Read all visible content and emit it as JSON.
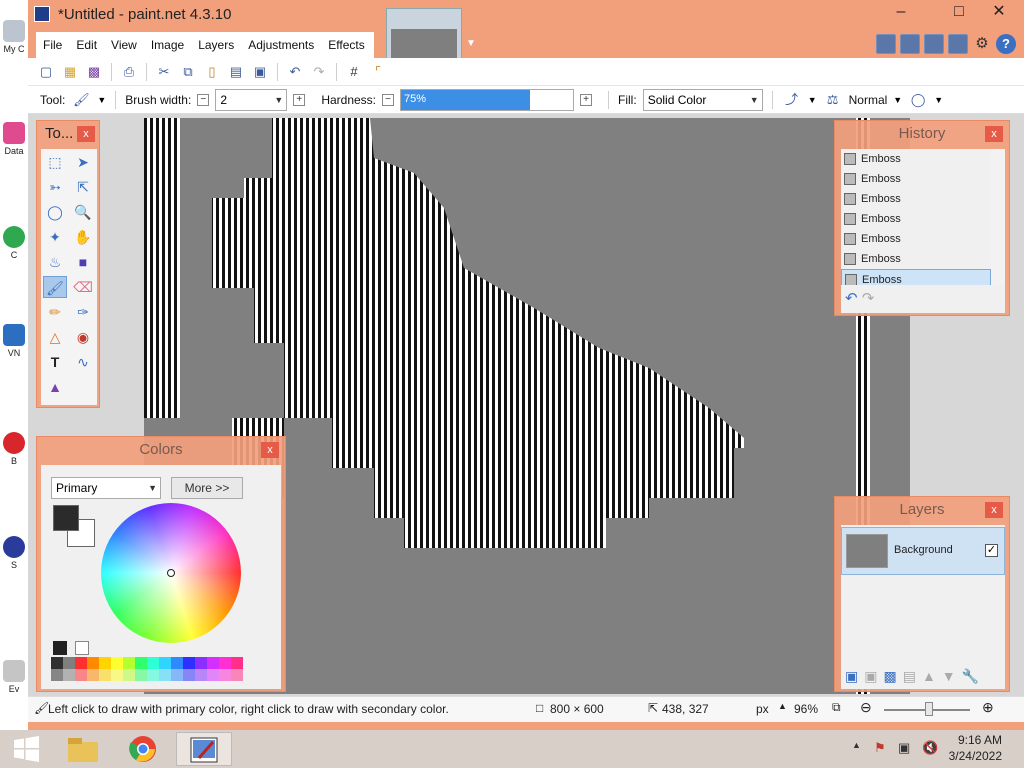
{
  "window": {
    "title": "*Untitled - paint.net 4.3.10",
    "minimize": "‒",
    "maximize": "□",
    "close": "✕"
  },
  "menu": [
    "File",
    "Edit",
    "View",
    "Image",
    "Layers",
    "Adjustments",
    "Effects"
  ],
  "toolbar": {
    "tool_label": "Tool:",
    "brush_width_label": "Brush width:",
    "brush_width_value": "2",
    "hardness_label": "Hardness:",
    "hardness_value": "75%",
    "hardness_fraction": 0.75,
    "fill_label": "Fill:",
    "fill_value": "Solid Color",
    "blend_mode": "Normal"
  },
  "tools_panel": {
    "title": "To...",
    "close": "x",
    "tools": [
      "rectangle-select-icon",
      "move-selection-icon",
      "lasso-select-icon",
      "move-selected-icon",
      "ellipse-select-icon",
      "zoom-icon",
      "magic-wand-icon",
      "pan-icon",
      "paint-bucket-icon",
      "gradient-icon",
      "paintbrush-icon",
      "eraser-icon",
      "pencil-icon",
      "color-picker-icon",
      "clone-stamp-icon",
      "recolor-icon",
      "text-icon",
      "line-curve-icon",
      "shapes-icon"
    ]
  },
  "colors_panel": {
    "title": "Colors",
    "close": "x",
    "mode": "Primary",
    "more_button": "More >>",
    "primary_color": "#2b2b2b",
    "secondary_color": "#ffffff",
    "palette": [
      "#303030",
      "#7f7f7f",
      "#ff2f2f",
      "#ff8a00",
      "#ffd400",
      "#ffff2f",
      "#b4ff2f",
      "#2fff6a",
      "#2fffd4",
      "#2fd4ff",
      "#2f8aff",
      "#2f2fff",
      "#8a2fff",
      "#d42fff",
      "#ff2fd4",
      "#ff2f8a"
    ]
  },
  "history_panel": {
    "title": "History",
    "close": "x",
    "items": [
      "Emboss",
      "Emboss",
      "Emboss",
      "Emboss",
      "Emboss",
      "Emboss",
      "Emboss"
    ],
    "selected_index": 6
  },
  "layers_panel": {
    "title": "Layers",
    "close": "x",
    "layers": [
      {
        "name": "Background",
        "visible": true
      }
    ]
  },
  "status": {
    "hint": "Left click to draw with primary color, right click to draw with secondary color.",
    "image_size": "800 × 600",
    "cursor_pos": "438, 327",
    "unit": "px",
    "zoom": "96%"
  },
  "taskbar": {
    "time": "9:16 AM",
    "date": "3/24/2022"
  },
  "desktop_icons": [
    "My C",
    "Data",
    "C",
    "VN",
    "B",
    "S",
    "Ev"
  ]
}
